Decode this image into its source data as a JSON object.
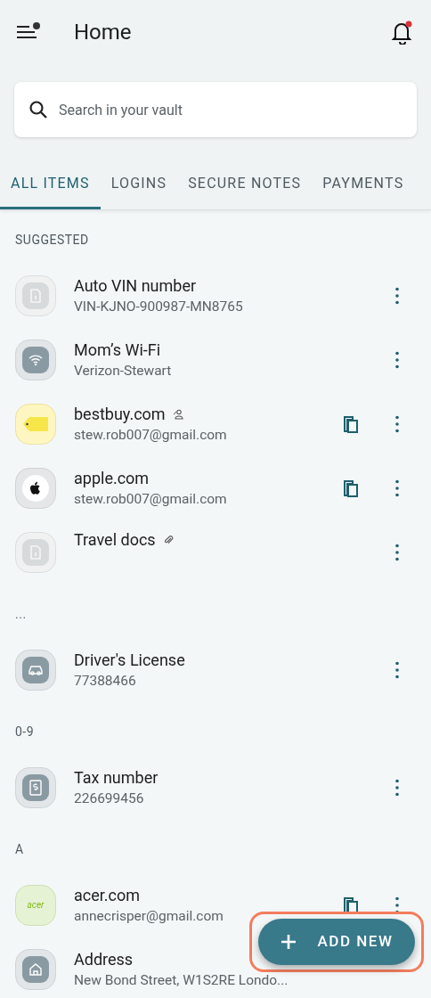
{
  "header": {
    "title": "Home",
    "menu_badge": true,
    "notification_badge": true
  },
  "search": {
    "placeholder": "Search in your vault"
  },
  "tabs": [
    {
      "label": "ALL ITEMS",
      "selected": true
    },
    {
      "label": "LOGINS",
      "selected": false
    },
    {
      "label": "SECURE NOTES",
      "selected": false
    },
    {
      "label": "PAYMENTS",
      "selected": false
    }
  ],
  "sections": [
    {
      "title": "SUGGESTED",
      "items": [
        {
          "kind": "document",
          "title": "Auto VIN number",
          "subtitle": "VIN-KJNO-900987-MN8765",
          "copy": false,
          "menu": true
        },
        {
          "kind": "wifi",
          "title": "Mom’s Wi-Fi",
          "subtitle": "Verizon-Stewart",
          "copy": false,
          "menu": true
        },
        {
          "kind": "tag",
          "title": "bestbuy.com",
          "subtitle": "stew.rob007@gmail.com",
          "badge": {
            "kind": "shared"
          },
          "copy": true,
          "menu": true
        },
        {
          "kind": "apple",
          "title": "apple.com",
          "subtitle": "stew.rob007@gmail.com",
          "copy": true,
          "menu": true
        },
        {
          "kind": "document",
          "title": "Travel docs",
          "badge": {
            "kind": "attachment"
          },
          "copy": false,
          "menu": true
        }
      ]
    },
    {
      "title": "...",
      "items": [
        {
          "kind": "car",
          "title": "Driver's License",
          "subtitle": "77388466",
          "copy": false,
          "menu": true
        }
      ]
    },
    {
      "title": "0-9",
      "items": [
        {
          "kind": "receipt",
          "title": "Tax number",
          "subtitle": "226699456",
          "copy": false,
          "menu": true
        }
      ]
    },
    {
      "title": "A",
      "items": [
        {
          "kind": "acer",
          "logo_text": "acer",
          "title": "acer.com",
          "subtitle": "annecrisper@gmail.com",
          "copy": true,
          "menu": true
        },
        {
          "kind": "home",
          "title": "Address",
          "subtitle": "New Bond Street, W1S2RE Londo...",
          "copy": false,
          "menu": false
        }
      ]
    }
  ],
  "fab": {
    "label": "ADD NEW",
    "highlighted": true
  }
}
